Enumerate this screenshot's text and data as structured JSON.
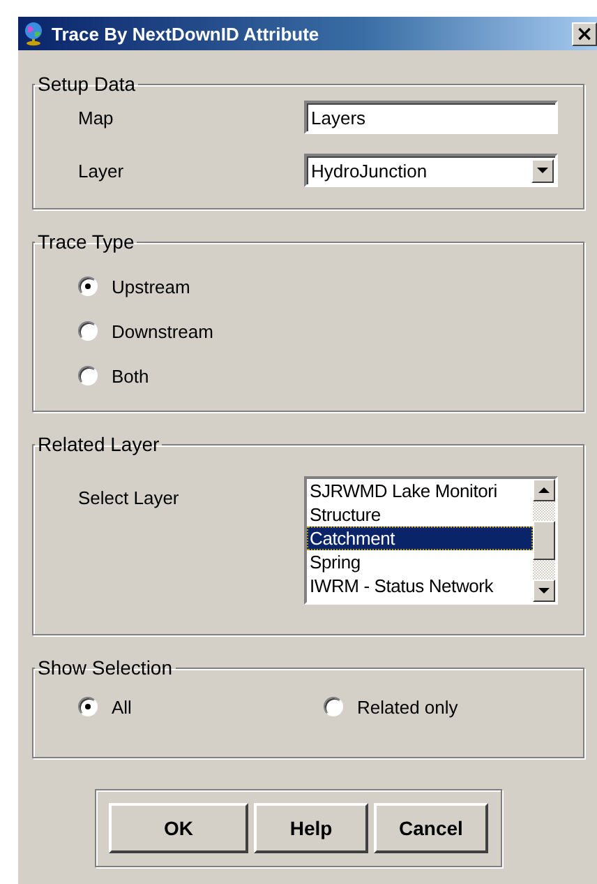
{
  "window": {
    "title": "Trace By NextDownID Attribute",
    "close": "×"
  },
  "setup_data": {
    "title": "Setup Data",
    "map_label": "Map",
    "map_value": "Layers",
    "layer_label": "Layer",
    "layer_value": "HydroJunction"
  },
  "trace_type": {
    "title": "Trace Type",
    "options": [
      {
        "label": "Upstream",
        "selected": true
      },
      {
        "label": "Downstream",
        "selected": false
      },
      {
        "label": "Both",
        "selected": false
      }
    ]
  },
  "related_layer": {
    "title": "Related Layer",
    "label": "Select Layer",
    "items": [
      {
        "label": "SJRWMD Lake Monitori",
        "selected": false
      },
      {
        "label": "Structure",
        "selected": false
      },
      {
        "label": "Catchment",
        "selected": true
      },
      {
        "label": "Spring",
        "selected": false
      },
      {
        "label": "IWRM - Status Network",
        "selected": false
      }
    ]
  },
  "show_selection": {
    "title": "Show Selection",
    "options": [
      {
        "label": "All",
        "selected": true
      },
      {
        "label": "Related only",
        "selected": false
      }
    ]
  },
  "buttons": [
    "OK",
    "Help",
    "Cancel"
  ]
}
